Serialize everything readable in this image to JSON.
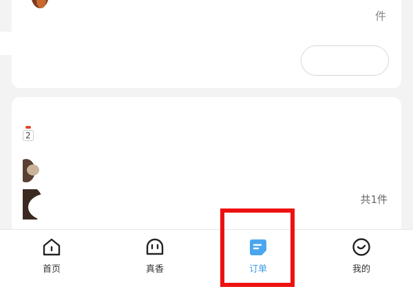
{
  "order_card_1": {
    "quantity_top": "",
    "quantity_unit": "件"
  },
  "order_card_2": {
    "status_text": "",
    "promo_number": "2",
    "total_qty": "共1件"
  },
  "tabbar": {
    "tabs": [
      {
        "label": "首页",
        "icon": "home-icon"
      },
      {
        "label": "真香",
        "icon": "face-icon"
      },
      {
        "label": "订单",
        "icon": "order-icon"
      },
      {
        "label": "我的",
        "icon": "profile-icon"
      }
    ],
    "active_index": 2,
    "active_color": "#3a9be8",
    "highlight_color": "#ee1111"
  }
}
